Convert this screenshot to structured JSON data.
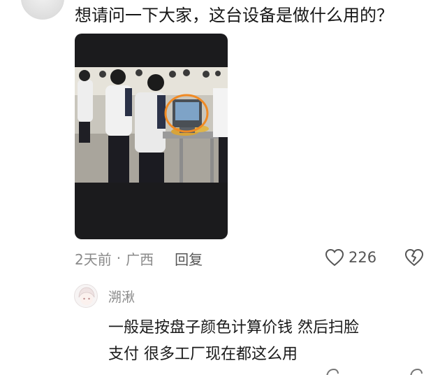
{
  "comment": {
    "question": "想请问一下大家，这台设备是做什么用的？",
    "time": "2天前",
    "separator": "·",
    "location": "广西",
    "reply_label": "回复",
    "likes": "226"
  },
  "reply": {
    "username": "溯湫",
    "line1": "一般是按盘子颜色计算价钱 然后扫脸",
    "line2": "支付 很多工厂现在都这么用"
  },
  "colors": {
    "highlight_circle": "#f08a24",
    "meta_text": "#8a8a8a"
  },
  "icons": [
    "avatar",
    "heart-icon",
    "broken-heart-icon"
  ]
}
